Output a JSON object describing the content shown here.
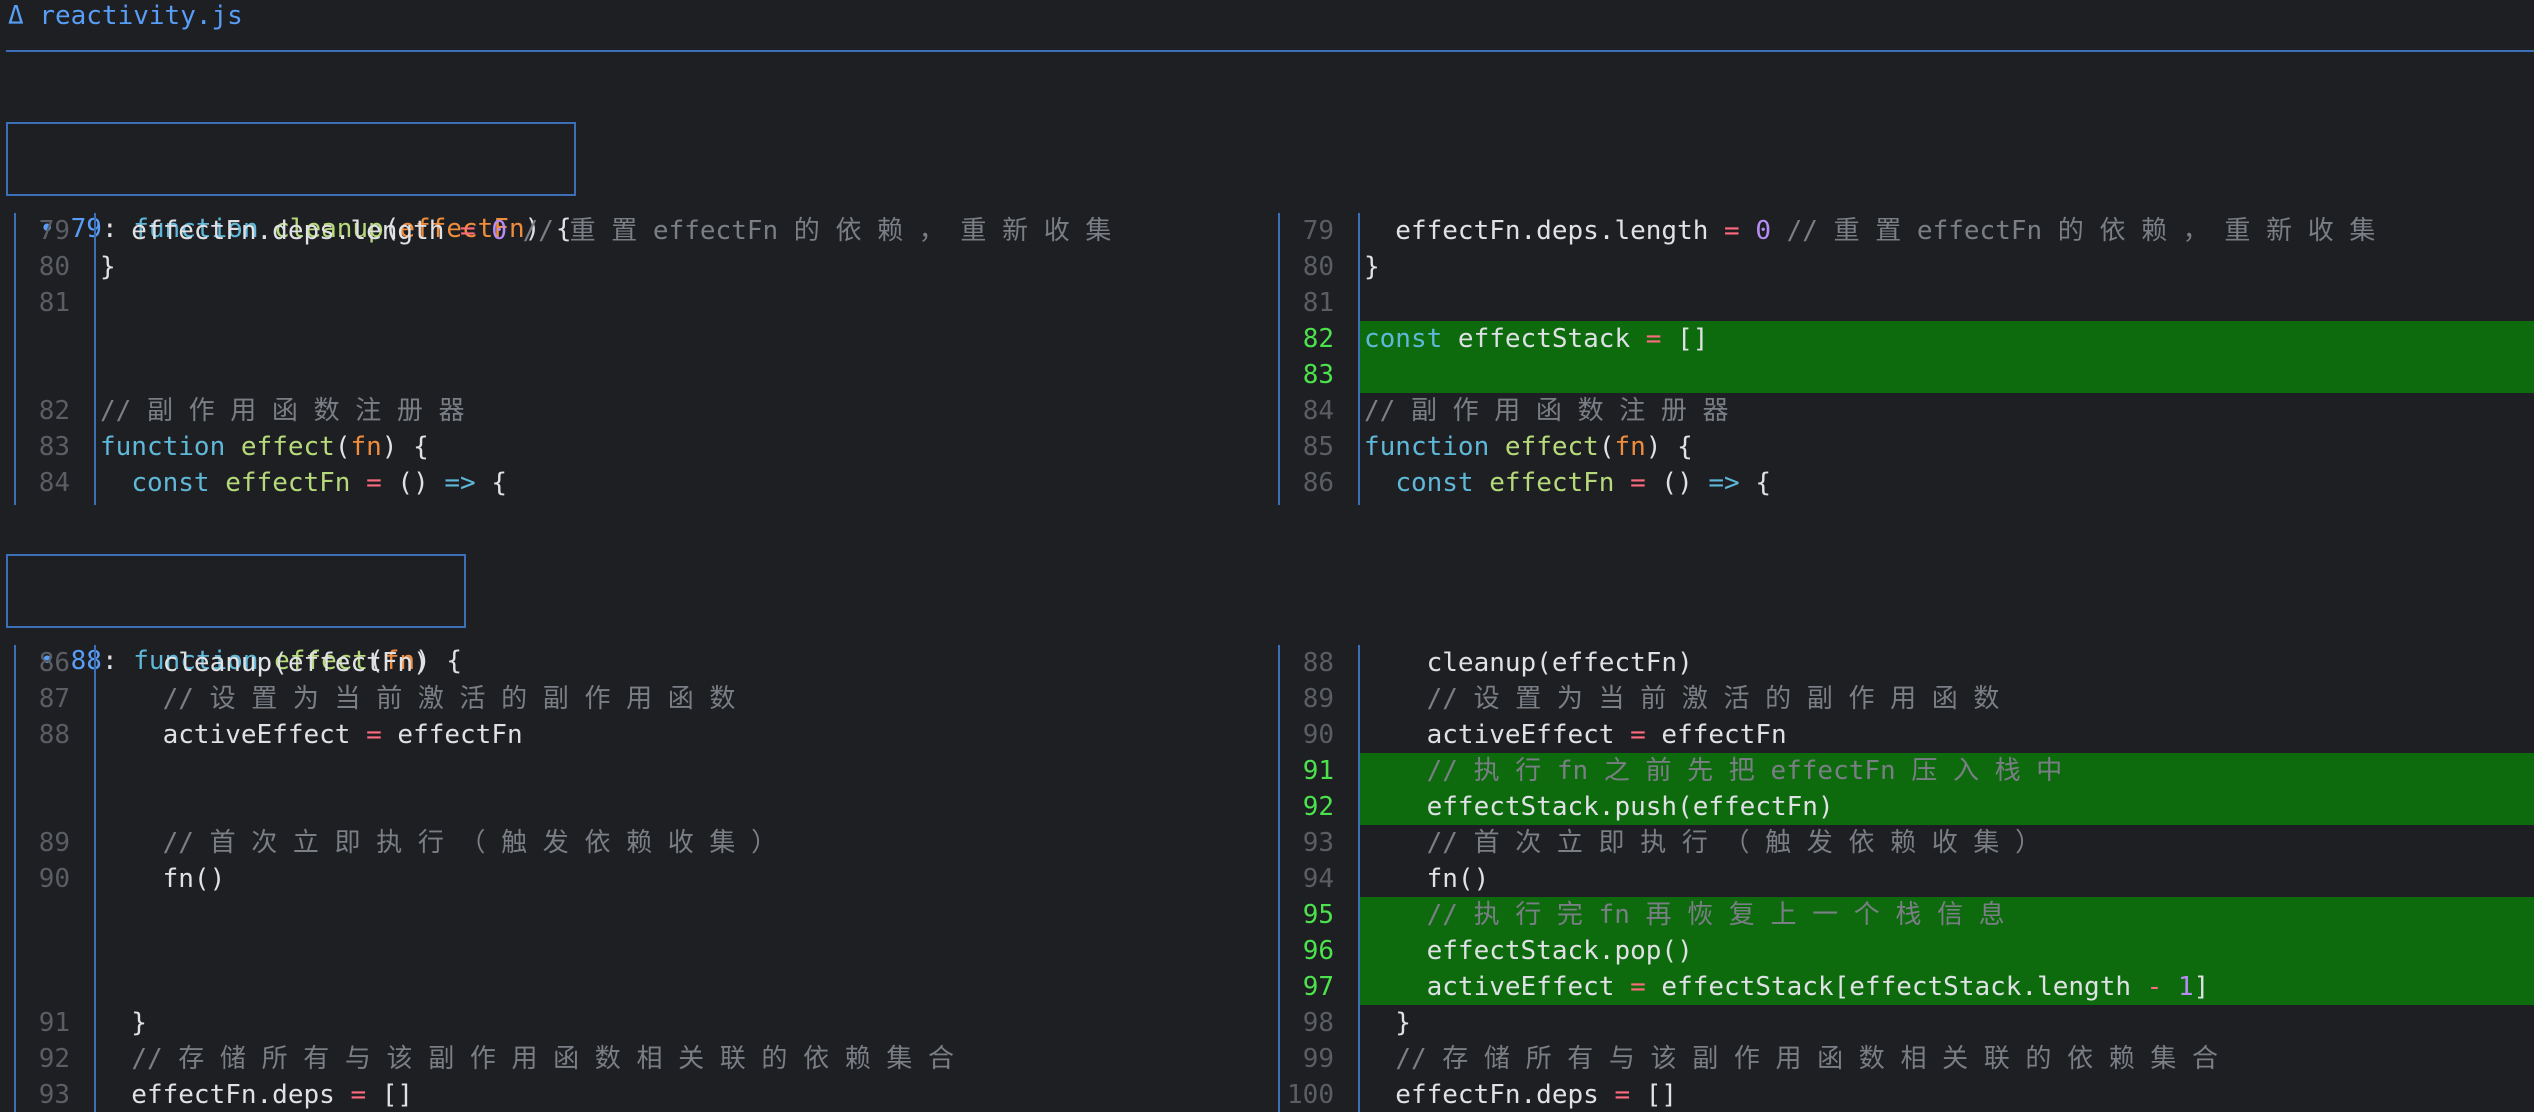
{
  "file": {
    "marker": "Δ",
    "name": "reactivity.js"
  },
  "hunks": [
    {
      "header": {
        "bullet": "•",
        "line": "79",
        "sep": ": ",
        "tokens": [
          [
            "kw",
            "function "
          ],
          [
            "fn",
            "cleanup"
          ],
          [
            "pl",
            "("
          ],
          [
            "pm",
            "effectFn"
          ],
          [
            "pl",
            ") {"
          ]
        ]
      },
      "left": [
        {
          "n": "79",
          "t": [
            [
              "pl",
              "  effectFn.deps.length "
            ],
            [
              "op",
              "="
            ],
            [
              "pl",
              " "
            ],
            [
              "num",
              "0"
            ],
            [
              "pl",
              " "
            ],
            [
              "cm",
              "// 重 置 effectFn 的 依 赖 ， 重 新 收 集"
            ]
          ]
        },
        {
          "n": "80",
          "t": [
            [
              "pl",
              "}"
            ]
          ]
        },
        {
          "n": "81",
          "t": []
        },
        {
          "blank": true
        },
        {
          "blank": true
        },
        {
          "n": "82",
          "t": [
            [
              "cm",
              "// 副 作 用 函 数 注 册 器"
            ]
          ]
        },
        {
          "n": "83",
          "t": [
            [
              "kw",
              "function "
            ],
            [
              "fn",
              "effect"
            ],
            [
              "pl",
              "("
            ],
            [
              "pm",
              "fn"
            ],
            [
              "pl",
              ") {"
            ]
          ]
        },
        {
          "n": "84",
          "t": [
            [
              "pl",
              "  "
            ],
            [
              "kw",
              "const "
            ],
            [
              "fn",
              "effectFn"
            ],
            [
              "pl",
              " "
            ],
            [
              "op",
              "="
            ],
            [
              "pl",
              " () "
            ],
            [
              "kw",
              "=>"
            ],
            [
              "pl",
              " {"
            ]
          ]
        }
      ],
      "right": [
        {
          "n": "79",
          "t": [
            [
              "pl",
              "  effectFn.deps.length "
            ],
            [
              "op",
              "="
            ],
            [
              "pl",
              " "
            ],
            [
              "num",
              "0"
            ],
            [
              "pl",
              " "
            ],
            [
              "cm",
              "// 重 置 effectFn 的 依 赖 ， 重 新 收 集"
            ]
          ]
        },
        {
          "n": "80",
          "t": [
            [
              "pl",
              "}"
            ]
          ]
        },
        {
          "n": "81",
          "t": []
        },
        {
          "n": "82",
          "added": true,
          "t": [
            [
              "kw",
              "const "
            ],
            [
              "pl",
              "effectStack "
            ],
            [
              "op",
              "="
            ],
            [
              "pl",
              " []"
            ]
          ]
        },
        {
          "n": "83",
          "added": true,
          "t": []
        },
        {
          "n": "84",
          "t": [
            [
              "cm",
              "// 副 作 用 函 数 注 册 器"
            ]
          ]
        },
        {
          "n": "85",
          "t": [
            [
              "kw",
              "function "
            ],
            [
              "fn",
              "effect"
            ],
            [
              "pl",
              "("
            ],
            [
              "pm",
              "fn"
            ],
            [
              "pl",
              ") {"
            ]
          ]
        },
        {
          "n": "86",
          "t": [
            [
              "pl",
              "  "
            ],
            [
              "kw",
              "const "
            ],
            [
              "fn",
              "effectFn"
            ],
            [
              "pl",
              " "
            ],
            [
              "op",
              "="
            ],
            [
              "pl",
              " () "
            ],
            [
              "kw",
              "=>"
            ],
            [
              "pl",
              " {"
            ]
          ]
        }
      ]
    },
    {
      "header": {
        "bullet": "•",
        "line": "88",
        "sep": ": ",
        "tokens": [
          [
            "kw",
            "function "
          ],
          [
            "fn",
            "effect"
          ],
          [
            "pl",
            "("
          ],
          [
            "pm",
            "fn"
          ],
          [
            "pl",
            ") {"
          ]
        ]
      },
      "left": [
        {
          "n": "86",
          "t": [
            [
              "pl",
              "    cleanup(effectFn)"
            ]
          ]
        },
        {
          "n": "87",
          "t": [
            [
              "pl",
              "    "
            ],
            [
              "cm",
              "// 设 置 为 当 前 激 活 的 副 作 用 函 数"
            ]
          ]
        },
        {
          "n": "88",
          "t": [
            [
              "pl",
              "    activeEffect "
            ],
            [
              "op",
              "="
            ],
            [
              "pl",
              " effectFn"
            ]
          ]
        },
        {
          "blank": true
        },
        {
          "blank": true
        },
        {
          "n": "89",
          "t": [
            [
              "pl",
              "    "
            ],
            [
              "cm",
              "// 首 次 立 即 执 行 （ 触 发 依 赖 收 集 ）"
            ]
          ]
        },
        {
          "n": "90",
          "t": [
            [
              "pl",
              "    fn()"
            ]
          ]
        },
        {
          "blank": true
        },
        {
          "blank": true
        },
        {
          "blank": true
        },
        {
          "n": "91",
          "t": [
            [
              "pl",
              "  }"
            ]
          ]
        },
        {
          "n": "92",
          "t": [
            [
              "pl",
              "  "
            ],
            [
              "cm",
              "// 存 储 所 有 与 该 副 作 用 函 数 相 关 联 的 依 赖 集 合"
            ]
          ]
        },
        {
          "n": "93",
          "t": [
            [
              "pl",
              "  effectFn.deps "
            ],
            [
              "op",
              "="
            ],
            [
              "pl",
              " []"
            ]
          ]
        }
      ],
      "right": [
        {
          "n": "88",
          "t": [
            [
              "pl",
              "    cleanup(effectFn)"
            ]
          ]
        },
        {
          "n": "89",
          "t": [
            [
              "pl",
              "    "
            ],
            [
              "cm",
              "// 设 置 为 当 前 激 活 的 副 作 用 函 数"
            ]
          ]
        },
        {
          "n": "90",
          "t": [
            [
              "pl",
              "    activeEffect "
            ],
            [
              "op",
              "="
            ],
            [
              "pl",
              " effectFn"
            ]
          ]
        },
        {
          "n": "91",
          "added": true,
          "t": [
            [
              "pl",
              "    "
            ],
            [
              "cm",
              "// 执 行 fn 之 前 先 把 effectFn 压 入 栈 中"
            ]
          ]
        },
        {
          "n": "92",
          "added": true,
          "t": [
            [
              "pl",
              "    effectStack.push(effectFn)"
            ]
          ]
        },
        {
          "n": "93",
          "t": [
            [
              "pl",
              "    "
            ],
            [
              "cm",
              "// 首 次 立 即 执 行 （ 触 发 依 赖 收 集 ）"
            ]
          ]
        },
        {
          "n": "94",
          "t": [
            [
              "pl",
              "    fn()"
            ]
          ]
        },
        {
          "n": "95",
          "added": true,
          "t": [
            [
              "pl",
              "    "
            ],
            [
              "cm",
              "// 执 行 完 fn 再 恢 复 上 一 个 栈 信 息"
            ]
          ]
        },
        {
          "n": "96",
          "added": true,
          "t": [
            [
              "pl",
              "    effectStack.pop()"
            ]
          ]
        },
        {
          "n": "97",
          "added": true,
          "t": [
            [
              "pl",
              "    activeEffect "
            ],
            [
              "op",
              "="
            ],
            [
              "pl",
              " effectStack[effectStack.length "
            ],
            [
              "op",
              "-"
            ],
            [
              "pl",
              " "
            ],
            [
              "num",
              "1"
            ],
            [
              "pl",
              "]"
            ]
          ]
        },
        {
          "n": "98",
          "t": [
            [
              "pl",
              "  }"
            ]
          ]
        },
        {
          "n": "99",
          "t": [
            [
              "pl",
              "  "
            ],
            [
              "cm",
              "// 存 储 所 有 与 该 副 作 用 函 数 相 关 联 的 依 赖 集 合"
            ]
          ]
        },
        {
          "n": "100",
          "t": [
            [
              "pl",
              "  effectFn.deps "
            ],
            [
              "op",
              "="
            ],
            [
              "pl",
              " []"
            ]
          ]
        }
      ]
    }
  ]
}
